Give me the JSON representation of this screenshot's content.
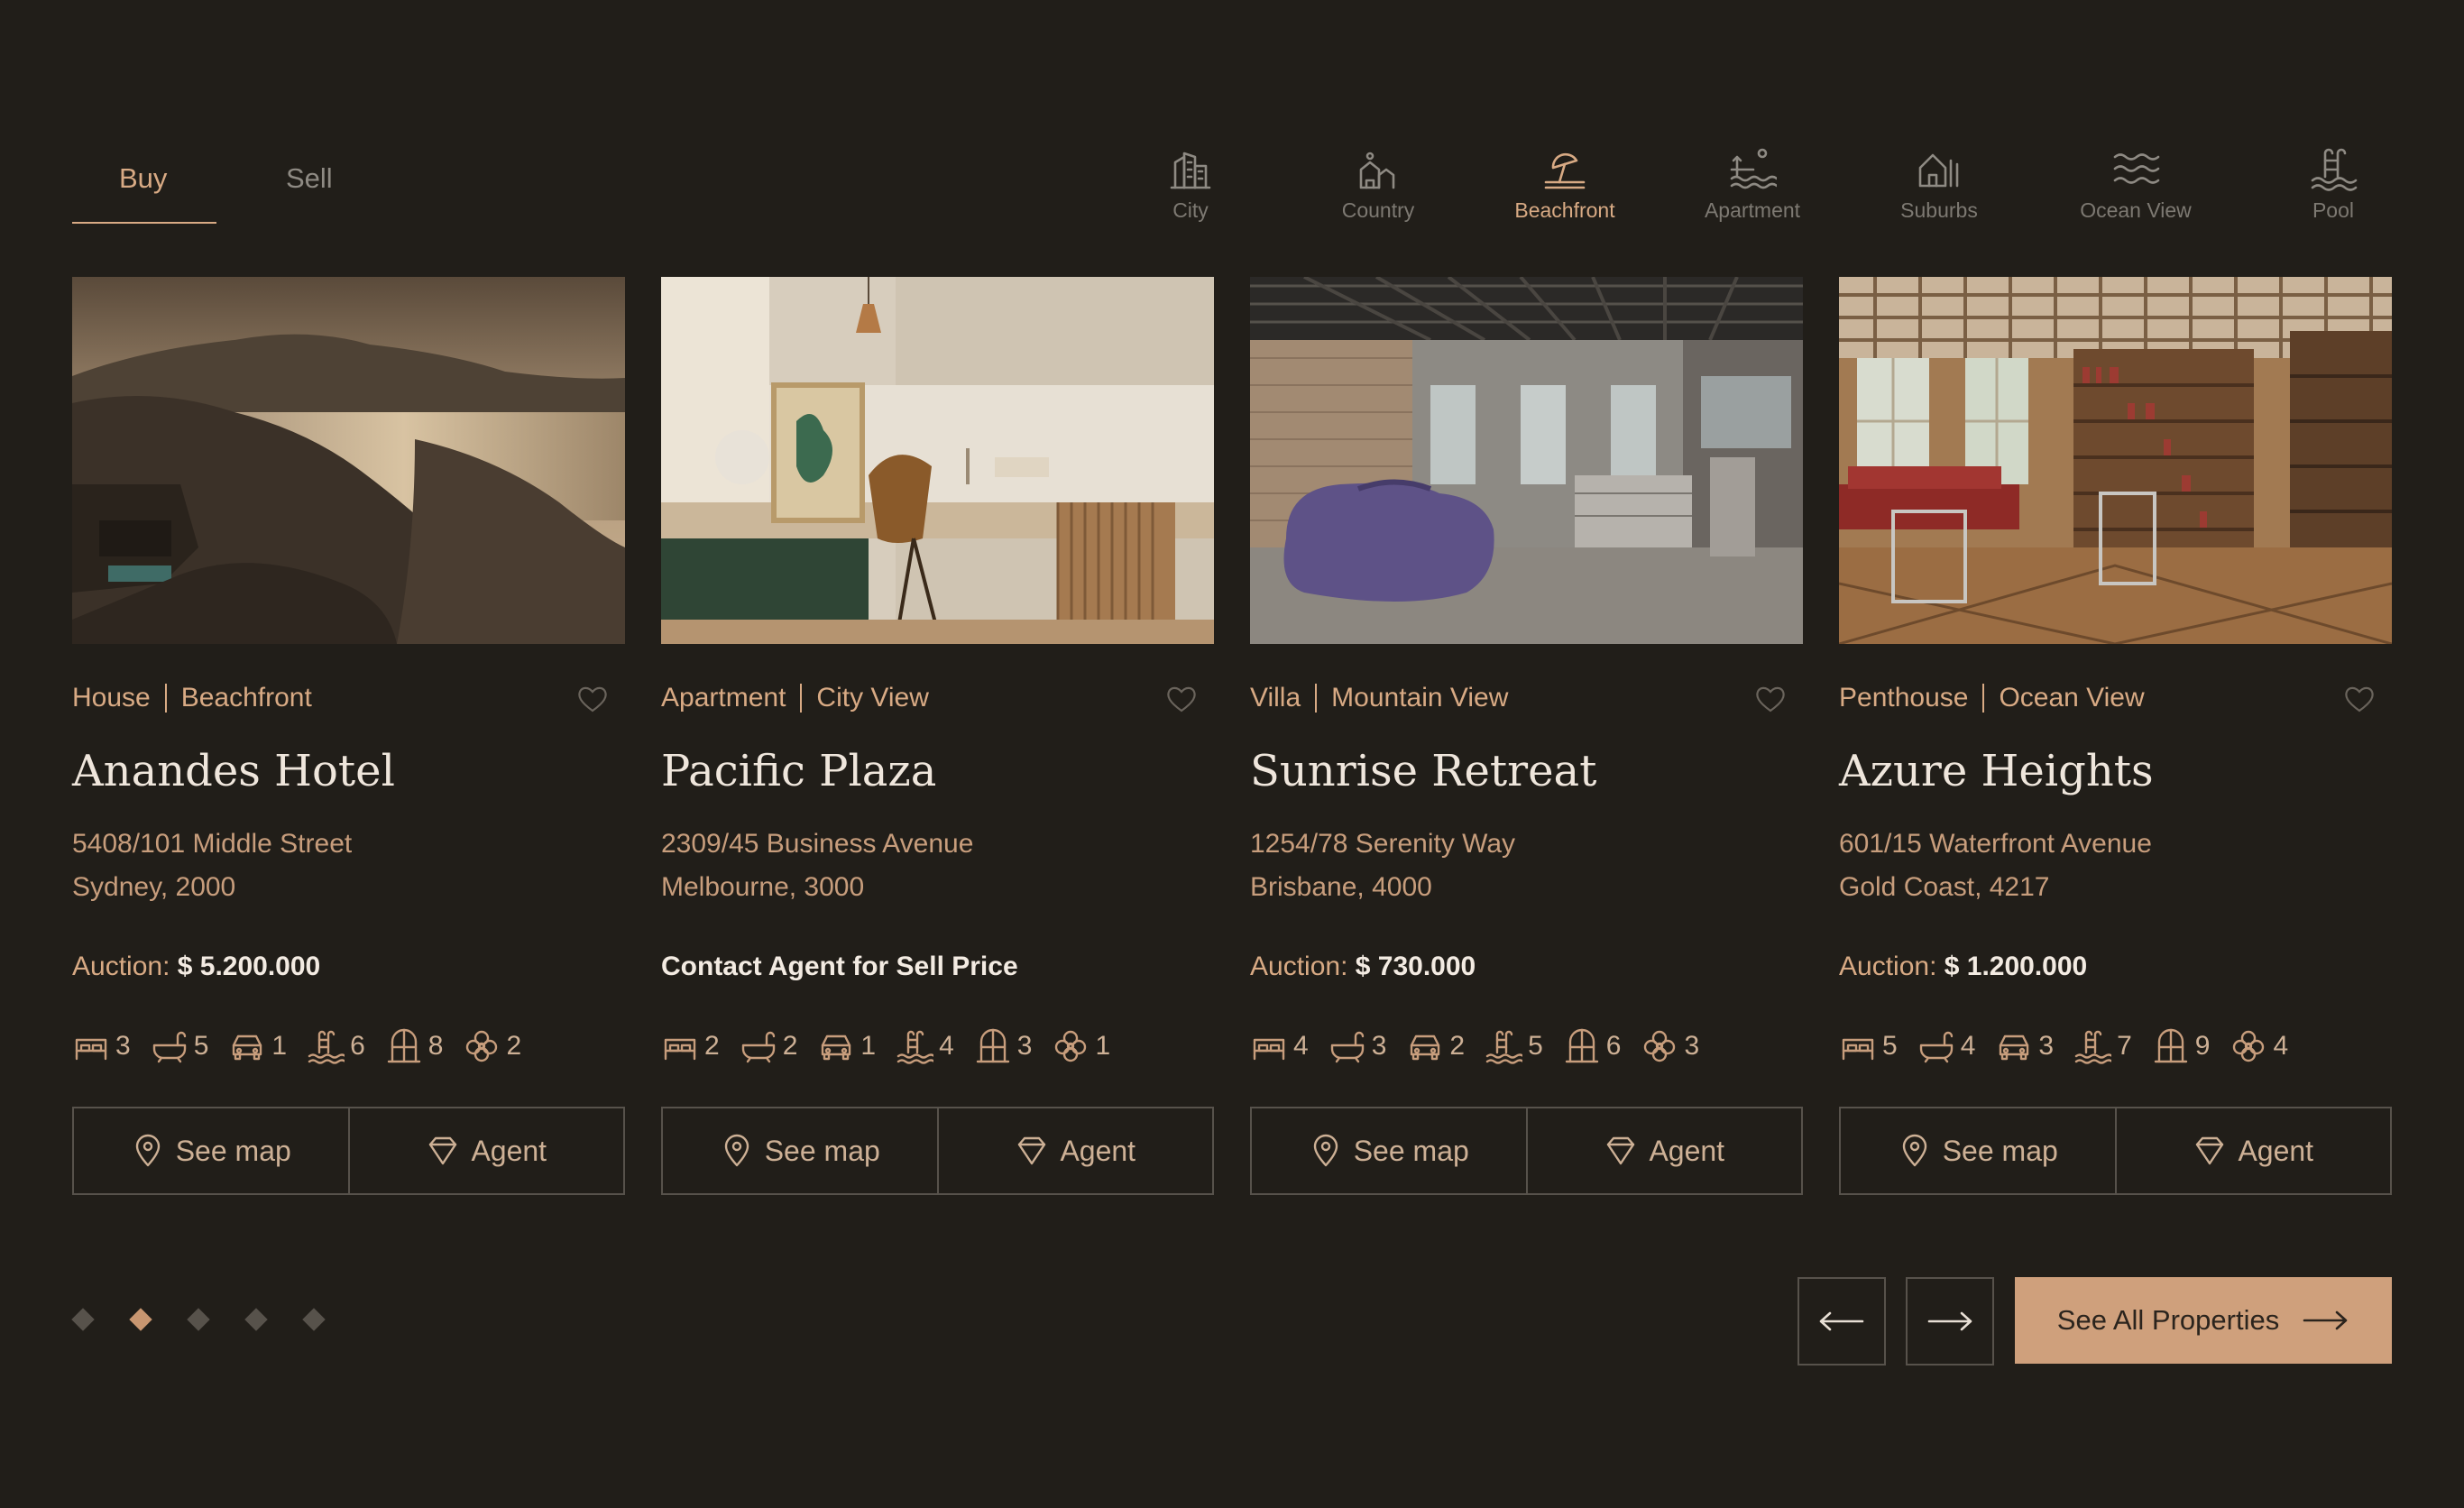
{
  "tabs": [
    {
      "label": "Buy",
      "active": true
    },
    {
      "label": "Sell",
      "active": false
    }
  ],
  "categories": [
    {
      "label": "City",
      "icon": "city-icon"
    },
    {
      "label": "Country",
      "icon": "country-icon"
    },
    {
      "label": "Beachfront",
      "icon": "beachfront-icon",
      "active": true
    },
    {
      "label": "Apartment",
      "icon": "apartment-icon"
    },
    {
      "label": "Suburbs",
      "icon": "suburbs-icon"
    },
    {
      "label": "Ocean View",
      "icon": "ocean-view-icon"
    },
    {
      "label": "Pool",
      "icon": "pool-icon"
    }
  ],
  "cards": [
    {
      "type": "House",
      "view": "Beachfront",
      "name": "Anandes Hotel",
      "address1": "5408/101 Middle Street",
      "address2": "Sydney, 2000",
      "price_prefix": "Auction:",
      "price_value": "$ 5.200.000",
      "features": [
        "3",
        "5",
        "1",
        "6",
        "8",
        "2"
      ],
      "image": "coastal-cliff-hotel-photo"
    },
    {
      "type": "Apartment",
      "view": "City View",
      "name": "Pacific Plaza",
      "address1": "2309/45 Business Avenue",
      "address2": "Melbourne, 3000",
      "price_contact": "Contact Agent for Sell Price",
      "features": [
        "2",
        "2",
        "1",
        "4",
        "3",
        "1"
      ],
      "image": "interior-desk-chair-photo"
    },
    {
      "type": "Villa",
      "view": "Mountain View",
      "name": "Sunrise Retreat",
      "address1": "1254/78 Serenity Way",
      "address2": "Brisbane, 4000",
      "price_prefix": "Auction:",
      "price_value": "$ 730.000",
      "features": [
        "4",
        "3",
        "2",
        "5",
        "6",
        "3"
      ],
      "image": "loft-purple-sofa-photo"
    },
    {
      "type": "Penthouse",
      "view": "Ocean View",
      "name": "Azure Heights",
      "address1": "601/15 Waterfront Avenue",
      "address2": "Gold Coast, 4217",
      "price_prefix": "Auction:",
      "price_value": "$ 1.200.000",
      "features": [
        "5",
        "4",
        "3",
        "7",
        "9",
        "4"
      ],
      "image": "library-lounge-photo"
    }
  ],
  "feature_icons": [
    "bed-icon",
    "bath-icon",
    "car-icon",
    "pool-icon",
    "door-icon",
    "garden-icon"
  ],
  "actions": {
    "map": "See map",
    "agent": "Agent"
  },
  "pagination": {
    "count": 5,
    "active_index": 1
  },
  "see_all": "See All Properties",
  "colors": {
    "background": "#211e19",
    "accent": "#cfa07c",
    "muted": "#8e8a83",
    "text": "#efe6dc"
  }
}
